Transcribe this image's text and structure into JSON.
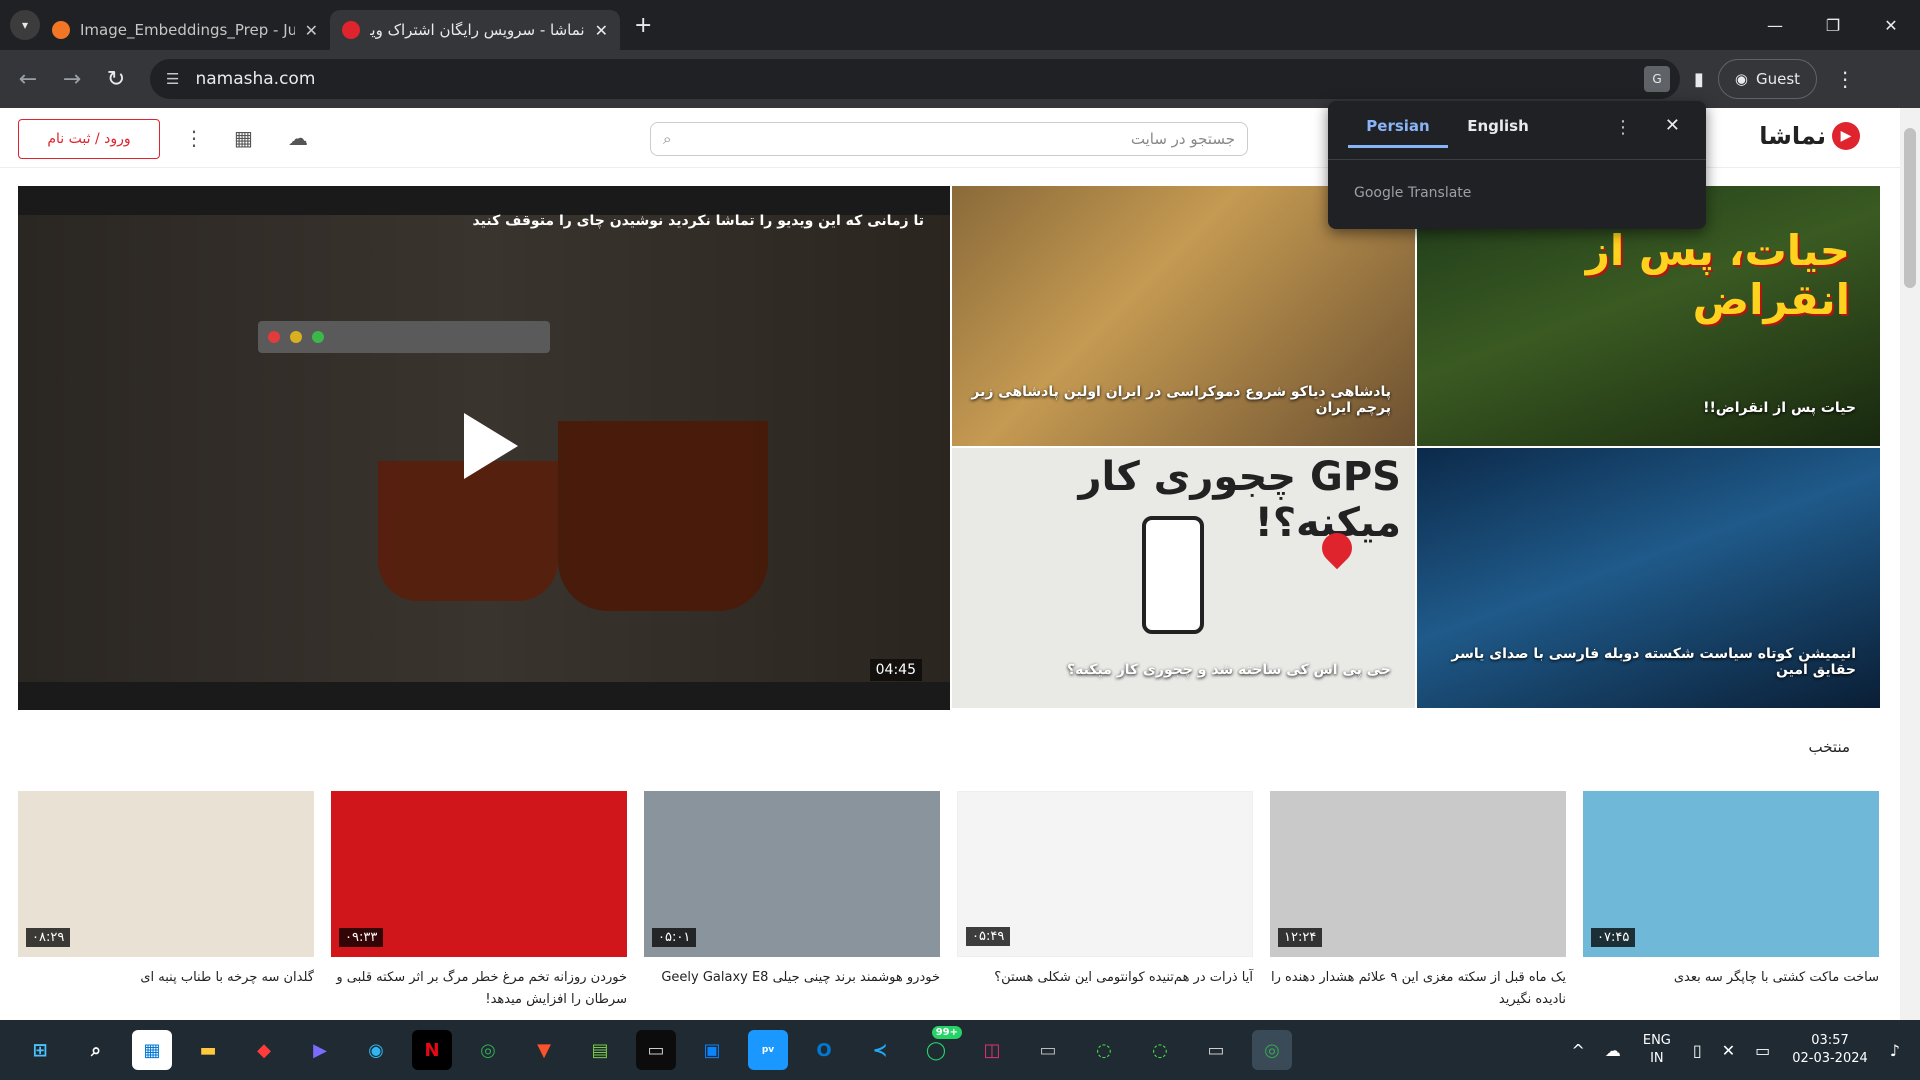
{
  "browser": {
    "tabs": [
      {
        "title": "Image_Embeddings_Prep - Jupy",
        "active": false
      },
      {
        "title": "نماشا - سرویس رایگان اشتراک ویدیو",
        "active": true
      }
    ],
    "url": "namasha.com",
    "profile": "Guest"
  },
  "header": {
    "login": "ورود / ثبت نام",
    "search_placeholder": "جستجو در سایت",
    "logo": "نماشا"
  },
  "translate_popup": {
    "tab_persian": "Persian",
    "tab_english": "English",
    "brand": "Google Translate"
  },
  "hero": {
    "title": "تا زمانی که این ویدیو را تماشا نکردید نوشیدن چای را متوقف کنید",
    "duration": "04:45"
  },
  "tiles": [
    {
      "caption": "پادشاهی دیاکو شروع دموکراسی در ایران اولین پادشاهی زیر پرچم ایران",
      "overlay": ""
    },
    {
      "caption": "حیات پس از انقراض!!",
      "overlay": "حیات، پس از انقراض"
    },
    {
      "caption": "جی پی اس کی ساخته شد و چجوری کار میکنه؟",
      "overlay": "GPS چجوری کار میکنه؟!"
    },
    {
      "caption": "انیمیشن کوتاه سیاست شکسته دوبله فارسی با صدای یاسر حقایق امین",
      "overlay": ""
    }
  ],
  "section_title": "منتخب",
  "cards": [
    {
      "title": "گلدان سه چرخه با طناب پنبه ای",
      "duration": "۰۸:۲۹",
      "color": "#e8e1d4"
    },
    {
      "title": "خوردن روزانه تخم مرغ خطر مرگ بر اثر سکته قلبی و سرطان را افزایش میدهد!",
      "duration": "۰۹:۳۳",
      "color": "#d0151b"
    },
    {
      "title": "خودرو هوشمند برند چینی جیلی Geely Galaxy E8",
      "duration": "۰۵:۰۱",
      "color": "#8a949c"
    },
    {
      "title": "آیا ذرات در هم‌تنیده کوانتومی این شکلی هستن؟",
      "duration": "۰۵:۴۹",
      "color": "#f4f4f4"
    },
    {
      "title": "یک ماه قبل از سکته مغزی این ۹ علائم هشدار دهنده را نادیده نگیرید",
      "duration": "۱۲:۲۴",
      "color": "#c9c9c9"
    },
    {
      "title": "ساخت ماکت کشتی با چاپگر سه بعدی",
      "duration": "۰۷:۴۵",
      "color": "#6fb8d8"
    }
  ],
  "taskbar": {
    "lang_top": "ENG",
    "lang_bottom": "IN",
    "time": "03:57",
    "date": "02-03-2024",
    "whatsapp_badge": "99+"
  }
}
